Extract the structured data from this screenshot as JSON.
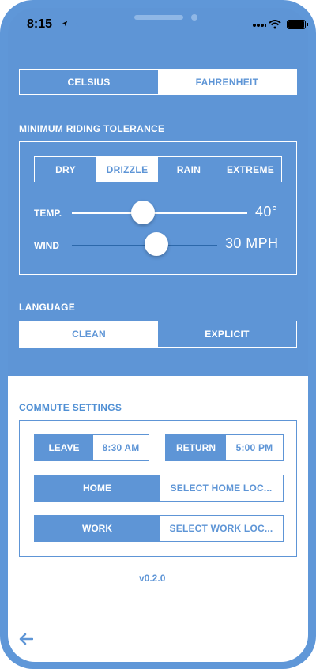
{
  "status_bar": {
    "time": "8:15"
  },
  "units": {
    "options": [
      "CELSIUS",
      "FAHRENHEIT"
    ],
    "selected": "FAHRENHEIT"
  },
  "tolerance": {
    "label": "MINIMUM RIDING TOLERANCE",
    "conditions": [
      "DRY",
      "DRIZZLE",
      "RAIN",
      "EXTREME"
    ],
    "selected_condition": "DRIZZLE",
    "temp": {
      "label": "TEMP.",
      "value": "40°",
      "level": 0.41
    },
    "wind": {
      "label": "WIND",
      "value": "30 MPH",
      "level": 0.58
    }
  },
  "language": {
    "label": "LANGUAGE",
    "options": [
      "CLEAN",
      "EXPLICIT"
    ],
    "selected": "CLEAN"
  },
  "commute": {
    "label": "COMMUTE SETTINGS",
    "leave": {
      "label": "LEAVE",
      "value": "8:30 AM"
    },
    "return": {
      "label": "RETURN",
      "value": "5:00 PM"
    },
    "home": {
      "label": "HOME",
      "value": "SELECT HOME LOC..."
    },
    "work": {
      "label": "WORK",
      "value": "SELECT WORK LOC..."
    }
  },
  "version": "v0.2.0",
  "icons": [
    "location-arrow-icon",
    "signal-icon",
    "wifi-icon",
    "battery-icon",
    "back-arrow-icon"
  ],
  "colors": {
    "primary_blue": "#5e95d6",
    "white": "#ffffff",
    "slider_dark": "#2c68aa"
  }
}
